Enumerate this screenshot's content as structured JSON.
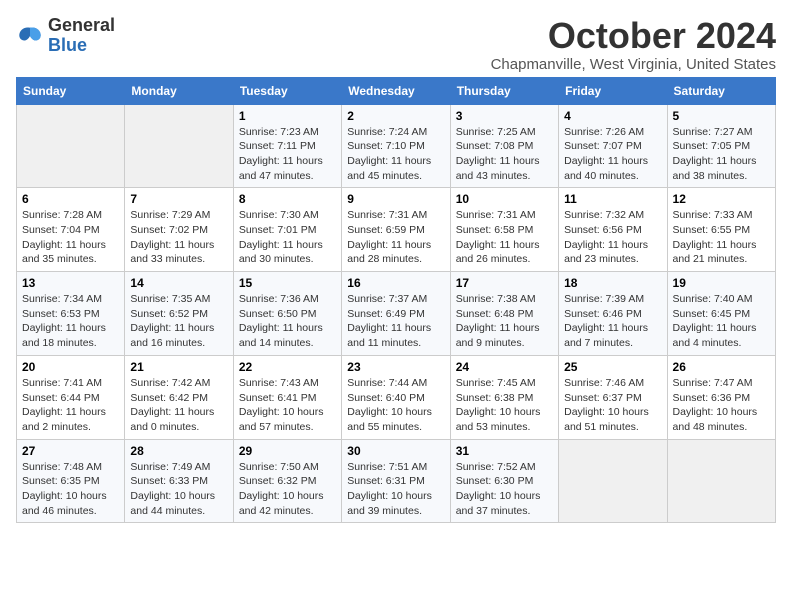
{
  "logo": {
    "general": "General",
    "blue": "Blue"
  },
  "title": "October 2024",
  "location": "Chapmanville, West Virginia, United States",
  "weekdays": [
    "Sunday",
    "Monday",
    "Tuesday",
    "Wednesday",
    "Thursday",
    "Friday",
    "Saturday"
  ],
  "weeks": [
    [
      {
        "day": "",
        "detail": ""
      },
      {
        "day": "",
        "detail": ""
      },
      {
        "day": "1",
        "detail": "Sunrise: 7:23 AM\nSunset: 7:11 PM\nDaylight: 11 hours and 47 minutes."
      },
      {
        "day": "2",
        "detail": "Sunrise: 7:24 AM\nSunset: 7:10 PM\nDaylight: 11 hours and 45 minutes."
      },
      {
        "day": "3",
        "detail": "Sunrise: 7:25 AM\nSunset: 7:08 PM\nDaylight: 11 hours and 43 minutes."
      },
      {
        "day": "4",
        "detail": "Sunrise: 7:26 AM\nSunset: 7:07 PM\nDaylight: 11 hours and 40 minutes."
      },
      {
        "day": "5",
        "detail": "Sunrise: 7:27 AM\nSunset: 7:05 PM\nDaylight: 11 hours and 38 minutes."
      }
    ],
    [
      {
        "day": "6",
        "detail": "Sunrise: 7:28 AM\nSunset: 7:04 PM\nDaylight: 11 hours and 35 minutes."
      },
      {
        "day": "7",
        "detail": "Sunrise: 7:29 AM\nSunset: 7:02 PM\nDaylight: 11 hours and 33 minutes."
      },
      {
        "day": "8",
        "detail": "Sunrise: 7:30 AM\nSunset: 7:01 PM\nDaylight: 11 hours and 30 minutes."
      },
      {
        "day": "9",
        "detail": "Sunrise: 7:31 AM\nSunset: 6:59 PM\nDaylight: 11 hours and 28 minutes."
      },
      {
        "day": "10",
        "detail": "Sunrise: 7:31 AM\nSunset: 6:58 PM\nDaylight: 11 hours and 26 minutes."
      },
      {
        "day": "11",
        "detail": "Sunrise: 7:32 AM\nSunset: 6:56 PM\nDaylight: 11 hours and 23 minutes."
      },
      {
        "day": "12",
        "detail": "Sunrise: 7:33 AM\nSunset: 6:55 PM\nDaylight: 11 hours and 21 minutes."
      }
    ],
    [
      {
        "day": "13",
        "detail": "Sunrise: 7:34 AM\nSunset: 6:53 PM\nDaylight: 11 hours and 18 minutes."
      },
      {
        "day": "14",
        "detail": "Sunrise: 7:35 AM\nSunset: 6:52 PM\nDaylight: 11 hours and 16 minutes."
      },
      {
        "day": "15",
        "detail": "Sunrise: 7:36 AM\nSunset: 6:50 PM\nDaylight: 11 hours and 14 minutes."
      },
      {
        "day": "16",
        "detail": "Sunrise: 7:37 AM\nSunset: 6:49 PM\nDaylight: 11 hours and 11 minutes."
      },
      {
        "day": "17",
        "detail": "Sunrise: 7:38 AM\nSunset: 6:48 PM\nDaylight: 11 hours and 9 minutes."
      },
      {
        "day": "18",
        "detail": "Sunrise: 7:39 AM\nSunset: 6:46 PM\nDaylight: 11 hours and 7 minutes."
      },
      {
        "day": "19",
        "detail": "Sunrise: 7:40 AM\nSunset: 6:45 PM\nDaylight: 11 hours and 4 minutes."
      }
    ],
    [
      {
        "day": "20",
        "detail": "Sunrise: 7:41 AM\nSunset: 6:44 PM\nDaylight: 11 hours and 2 minutes."
      },
      {
        "day": "21",
        "detail": "Sunrise: 7:42 AM\nSunset: 6:42 PM\nDaylight: 11 hours and 0 minutes."
      },
      {
        "day": "22",
        "detail": "Sunrise: 7:43 AM\nSunset: 6:41 PM\nDaylight: 10 hours and 57 minutes."
      },
      {
        "day": "23",
        "detail": "Sunrise: 7:44 AM\nSunset: 6:40 PM\nDaylight: 10 hours and 55 minutes."
      },
      {
        "day": "24",
        "detail": "Sunrise: 7:45 AM\nSunset: 6:38 PM\nDaylight: 10 hours and 53 minutes."
      },
      {
        "day": "25",
        "detail": "Sunrise: 7:46 AM\nSunset: 6:37 PM\nDaylight: 10 hours and 51 minutes."
      },
      {
        "day": "26",
        "detail": "Sunrise: 7:47 AM\nSunset: 6:36 PM\nDaylight: 10 hours and 48 minutes."
      }
    ],
    [
      {
        "day": "27",
        "detail": "Sunrise: 7:48 AM\nSunset: 6:35 PM\nDaylight: 10 hours and 46 minutes."
      },
      {
        "day": "28",
        "detail": "Sunrise: 7:49 AM\nSunset: 6:33 PM\nDaylight: 10 hours and 44 minutes."
      },
      {
        "day": "29",
        "detail": "Sunrise: 7:50 AM\nSunset: 6:32 PM\nDaylight: 10 hours and 42 minutes."
      },
      {
        "day": "30",
        "detail": "Sunrise: 7:51 AM\nSunset: 6:31 PM\nDaylight: 10 hours and 39 minutes."
      },
      {
        "day": "31",
        "detail": "Sunrise: 7:52 AM\nSunset: 6:30 PM\nDaylight: 10 hours and 37 minutes."
      },
      {
        "day": "",
        "detail": ""
      },
      {
        "day": "",
        "detail": ""
      }
    ]
  ]
}
